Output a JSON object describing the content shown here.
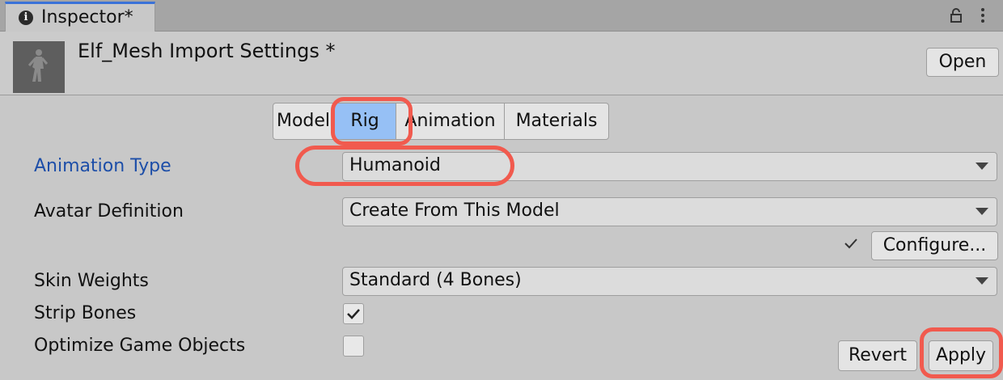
{
  "window": {
    "tab_title": "Inspector*",
    "icons": {
      "info": "info-icon",
      "lock": "lock-icon",
      "menu": "kebab-menu-icon"
    }
  },
  "header": {
    "title": "Elf_Mesh Import Settings *",
    "thumbnail": "character-model-thumbnail",
    "open_label": "Open"
  },
  "tabs": [
    {
      "label": "Model",
      "selected": false
    },
    {
      "label": "Rig",
      "selected": true
    },
    {
      "label": "Animation",
      "selected": false
    },
    {
      "label": "Materials",
      "selected": false
    }
  ],
  "fields": {
    "animation_type": {
      "label": "Animation Type",
      "value": "Humanoid"
    },
    "avatar_definition": {
      "label": "Avatar Definition",
      "value": "Create From This Model"
    },
    "configure_label": "Configure...",
    "skin_weights": {
      "label": "Skin Weights",
      "value": "Standard (4 Bones)"
    },
    "strip_bones": {
      "label": "Strip Bones",
      "checked": true
    },
    "optimize_game_objects": {
      "label": "Optimize Game Objects",
      "checked": false
    }
  },
  "footer": {
    "revert_label": "Revert",
    "apply_label": "Apply"
  },
  "colors": {
    "highlight": "#f15a4e",
    "selected_tab": "#96c0f5",
    "label_blue": "#1d4ea8"
  }
}
